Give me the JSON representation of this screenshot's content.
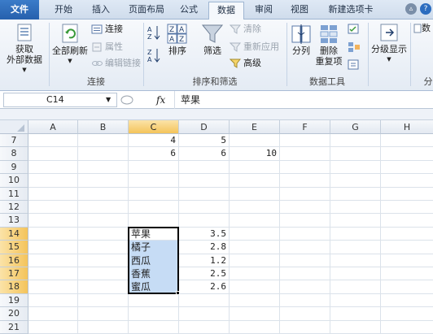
{
  "tabs": [
    {
      "label": "文件"
    },
    {
      "label": "开始"
    },
    {
      "label": "插入"
    },
    {
      "label": "页面布局"
    },
    {
      "label": "公式"
    },
    {
      "label": "数据"
    },
    {
      "label": "审阅"
    },
    {
      "label": "视图"
    },
    {
      "label": "新建选项卡"
    }
  ],
  "active_tab": "数据",
  "ribbon": {
    "get_external": {
      "line1": "获取",
      "line2": "外部数据"
    },
    "refresh_all": "全部刷新",
    "connections": "连接",
    "properties": "属性",
    "edit_links": "编辑链接",
    "group_connections": "连接",
    "sort_asc": "A→Z",
    "sort_btn": "排序",
    "filter_btn": "筛选",
    "clear": "清除",
    "reapply": "重新应用",
    "advanced": "高级",
    "group_sort_filter": "排序和筛选",
    "text_to_columns": "分列",
    "remove_duplicates": "删除",
    "remove_duplicates_2": "重复项",
    "group_data_tools": "数据工具",
    "outline": "分级显示",
    "right_clipped": "数",
    "right_clipped_grp": "分"
  },
  "formula_bar": {
    "name_box": "C14",
    "fx": "fx",
    "value": "苹果"
  },
  "columns": [
    "A",
    "B",
    "C",
    "D",
    "E",
    "F",
    "G",
    "H"
  ],
  "selected_column": "C",
  "rows": [
    "7",
    "8",
    "9",
    "10",
    "11",
    "12",
    "13",
    "14",
    "15",
    "16",
    "17",
    "18",
    "19",
    "20",
    "21",
    "22"
  ],
  "selected_rows": [
    "14",
    "15",
    "16",
    "17",
    "18"
  ],
  "cells": {
    "C7": "4",
    "D7": "5",
    "C8": "6",
    "D8": "6",
    "E8": "10",
    "C14": "苹果",
    "D14": "3.5",
    "C15": "橘子",
    "D15": "2.8",
    "C16": "西瓜",
    "D16": "1.2",
    "C17": "香蕉",
    "D17": "2.5",
    "C18": "蜜瓜",
    "D18": "2.6"
  },
  "colors": {
    "accent": "#2b6cbf",
    "selection": "#c6dcf5",
    "header_selected": "#f4c45b"
  }
}
